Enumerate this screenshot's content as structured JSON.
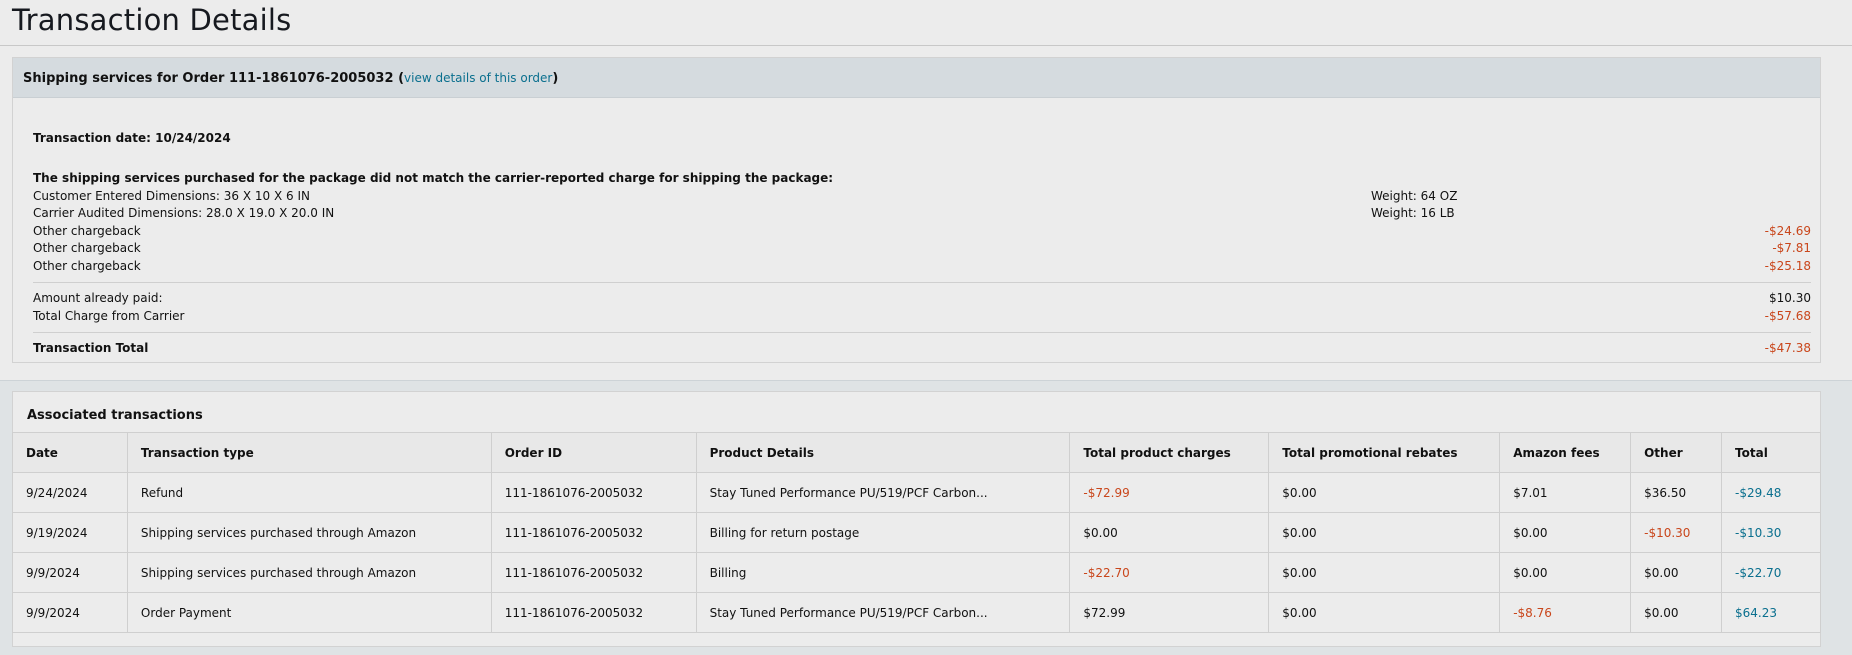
{
  "page": {
    "title": "Transaction Details"
  },
  "shipping": {
    "header_text": "Shipping services for Order 111-1861076-2005032",
    "header_link": "view details of this order",
    "transaction_date_label": "Transaction date: 10/24/2024",
    "mismatch_label": "The shipping services purchased for the package did not match the carrier-reported charge for shipping the package:",
    "customer_dims": "Customer Entered Dimensions: 36 X 10 X 6 IN",
    "customer_weight": "Weight: 64 OZ",
    "carrier_dims": "Carrier Audited Dimensions: 28.0 X 19.0 X 20.0 IN",
    "carrier_weight": "Weight: 16 LB",
    "chargebacks": [
      {
        "label": "Other chargeback",
        "amount": "-$24.69"
      },
      {
        "label": "Other chargeback",
        "amount": "-$7.81"
      },
      {
        "label": "Other chargeback",
        "amount": "-$25.18"
      }
    ],
    "already_paid_label": "Amount already paid:",
    "already_paid_amount": "$10.30",
    "carrier_total_label": "Total Charge from Carrier",
    "carrier_total_amount": "-$57.68",
    "transaction_total_label": "Transaction Total",
    "transaction_total_amount": "-$47.38"
  },
  "associated": {
    "title": "Associated transactions",
    "columns": [
      "Date",
      "Transaction type",
      "Order ID",
      "Product Details",
      "Total product charges",
      "Total promotional rebates",
      "Amazon fees",
      "Other",
      "Total"
    ],
    "rows": [
      [
        "9/24/2024",
        "Refund",
        "111-1861076-2005032",
        "Stay Tuned Performance PU/519/PCF Carbon...",
        "-$72.99",
        "$0.00",
        "$7.01",
        "$36.50",
        "-$29.48"
      ],
      [
        "9/19/2024",
        "Shipping services purchased through Amazon",
        "111-1861076-2005032",
        "Billing for return postage",
        "$0.00",
        "$0.00",
        "$0.00",
        "-$10.30",
        "-$10.30"
      ],
      [
        "9/9/2024",
        "Shipping services purchased through Amazon",
        "111-1861076-2005032",
        "Billing",
        "-$22.70",
        "$0.00",
        "$0.00",
        "$0.00",
        "-$22.70"
      ],
      [
        "9/9/2024",
        "Order Payment",
        "111-1861076-2005032",
        "Stay Tuned Performance PU/519/PCF Carbon...",
        "$72.99",
        "$0.00",
        "-$8.76",
        "$0.00",
        "$64.23"
      ]
    ]
  }
}
